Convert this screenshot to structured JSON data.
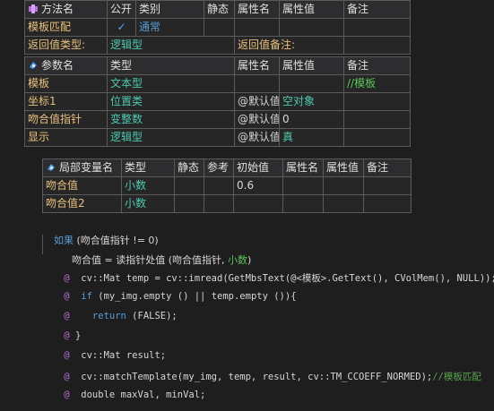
{
  "method_table": {
    "header": {
      "name": "方法名",
      "public": "公开",
      "type": "类别",
      "static": "静态",
      "attr_name": "属性名",
      "attr_value": "属性值",
      "remark": "备注"
    },
    "method": {
      "name": "模板匹配",
      "public_check": "✓",
      "type": "通常"
    },
    "return": {
      "label": "返回值类型:",
      "value": "逻辑型",
      "remark_label": "返回值备注:"
    }
  },
  "param_table": {
    "header": {
      "name": "参数名",
      "type": "类型",
      "attr_name": "属性名",
      "attr_value": "属性值",
      "remark": "备注"
    },
    "rows": [
      {
        "name": "模板",
        "type": "文本型",
        "attr_name": "",
        "attr_value": "",
        "remark": "//模板"
      },
      {
        "name": "坐标1",
        "type": "位置类",
        "attr_name": "@默认值",
        "attr_value": "空对象",
        "remark": ""
      },
      {
        "name": "吻合值指针",
        "type": "变整数",
        "attr_name": "@默认值",
        "attr_value": "0",
        "remark": ""
      },
      {
        "name": "显示",
        "type": "逻辑型",
        "attr_name": "@默认值",
        "attr_value": "真",
        "remark": ""
      }
    ]
  },
  "local_table": {
    "header": {
      "name": "局部变量名",
      "type": "类型",
      "static": "静态",
      "ref": "参考",
      "init": "初始值",
      "attr_name": "属性名",
      "attr_value": "属性值",
      "remark": "备注"
    },
    "rows": [
      {
        "name": "吻合值",
        "type": "小数",
        "init": "0.6"
      },
      {
        "name": "吻合值2",
        "type": "小数",
        "init": ""
      }
    ]
  },
  "code": {
    "l1_kw": "如果",
    "l1_rest": " (吻合值指针 != 0)",
    "l2": "吻合值 = 读指针处值 (吻合值指针, ",
    "l2_type": "小数",
    "l2_end": ")",
    "at": "@",
    "l3": "cv::Mat temp = cv::imread(GetMbsText(@<模板>.GetText(), CVolMem(), NULL));",
    "l4_kw": "if",
    "l4_rest": " (my_img.empty () || temp.empty ()){",
    "l5_kw": "return",
    "l5_rest": " (FALSE);",
    "l6": "}",
    "l7": "cv::Mat result;",
    "l8": "cv::matchTemplate(my_img, temp, result, cv::TM_CCOEFF_NORMED);",
    "l8_cmt": "//模板匹配",
    "l9": "double maxVal, minVal;"
  }
}
